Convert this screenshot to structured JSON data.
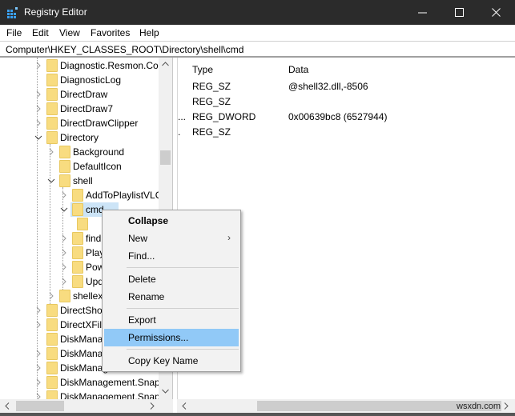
{
  "window": {
    "title": "Registry Editor",
    "controls": {
      "minimize": "minimize",
      "maximize": "maximize",
      "close": "close"
    },
    "accent": "#2b2b2b"
  },
  "menu": [
    "File",
    "Edit",
    "View",
    "Favorites",
    "Help"
  ],
  "address": "Computer\\HKEY_CLASSES_ROOT\\Directory\\shell\\cmd",
  "tree": {
    "items": [
      {
        "label": "Diagnostic.Resmon.Cor",
        "level": 0,
        "expander": "collapsed"
      },
      {
        "label": "DiagnosticLog",
        "level": 0,
        "expander": "none"
      },
      {
        "label": "DirectDraw",
        "level": 0,
        "expander": "collapsed"
      },
      {
        "label": "DirectDraw7",
        "level": 0,
        "expander": "collapsed"
      },
      {
        "label": "DirectDrawClipper",
        "level": 0,
        "expander": "collapsed"
      },
      {
        "label": "Directory",
        "level": 0,
        "expander": "expanded"
      },
      {
        "label": "Background",
        "level": 1,
        "expander": "collapsed"
      },
      {
        "label": "DefaultIcon",
        "level": 1,
        "expander": "none"
      },
      {
        "label": "shell",
        "level": 1,
        "expander": "expanded"
      },
      {
        "label": "AddToPlaylistVLC",
        "level": 2,
        "expander": "collapsed"
      },
      {
        "label": "cmd",
        "level": 2,
        "expander": "expanded",
        "selected": true
      },
      {
        "label": "",
        "level": 3,
        "expander": "none"
      },
      {
        "label": "find",
        "level": 2,
        "expander": "collapsed"
      },
      {
        "label": "Play",
        "level": 2,
        "expander": "collapsed"
      },
      {
        "label": "Pow",
        "level": 2,
        "expander": "collapsed"
      },
      {
        "label": "Upd",
        "level": 2,
        "expander": "collapsed"
      },
      {
        "label": "shellex",
        "level": 1,
        "expander": "collapsed"
      },
      {
        "label": "DirectSho",
        "level": 0,
        "expander": "collapsed"
      },
      {
        "label": "DirectXFil",
        "level": 0,
        "expander": "collapsed"
      },
      {
        "label": "DiskMana",
        "level": 0,
        "expander": "none"
      },
      {
        "label": "DiskMana",
        "level": 0,
        "expander": "collapsed"
      },
      {
        "label": "DiskManagement.Sna",
        "level": 0,
        "expander": "collapsed"
      },
      {
        "label": "DiskManagement.Snap",
        "level": 0,
        "expander": "collapsed"
      },
      {
        "label": "DiskManagement.Snap",
        "level": 0,
        "expander": "collapsed"
      }
    ]
  },
  "values": {
    "columns": {
      "type": "Type",
      "data": "Data"
    },
    "rows": [
      {
        "prefix": "",
        "type": "REG_SZ",
        "data": "@shell32.dll,-8506"
      },
      {
        "prefix": "",
        "type": "REG_SZ",
        "data": ""
      },
      {
        "prefix": "...",
        "type": "REG_DWORD",
        "data": "0x00639bc8 (6527944)"
      },
      {
        "prefix": ".",
        "type": "REG_SZ",
        "data": ""
      }
    ]
  },
  "context_menu": {
    "items": [
      {
        "label": "Collapse",
        "bold": true
      },
      {
        "label": "New",
        "submenu": true
      },
      {
        "label": "Find..."
      },
      {
        "separator": true
      },
      {
        "label": "Delete"
      },
      {
        "label": "Rename"
      },
      {
        "separator": true
      },
      {
        "label": "Export"
      },
      {
        "label": "Permissions...",
        "highlighted": true
      },
      {
        "separator": true
      },
      {
        "label": "Copy Key Name"
      }
    ],
    "highlight_color": "#91c9f7"
  },
  "watermark": "wsxdn.com"
}
